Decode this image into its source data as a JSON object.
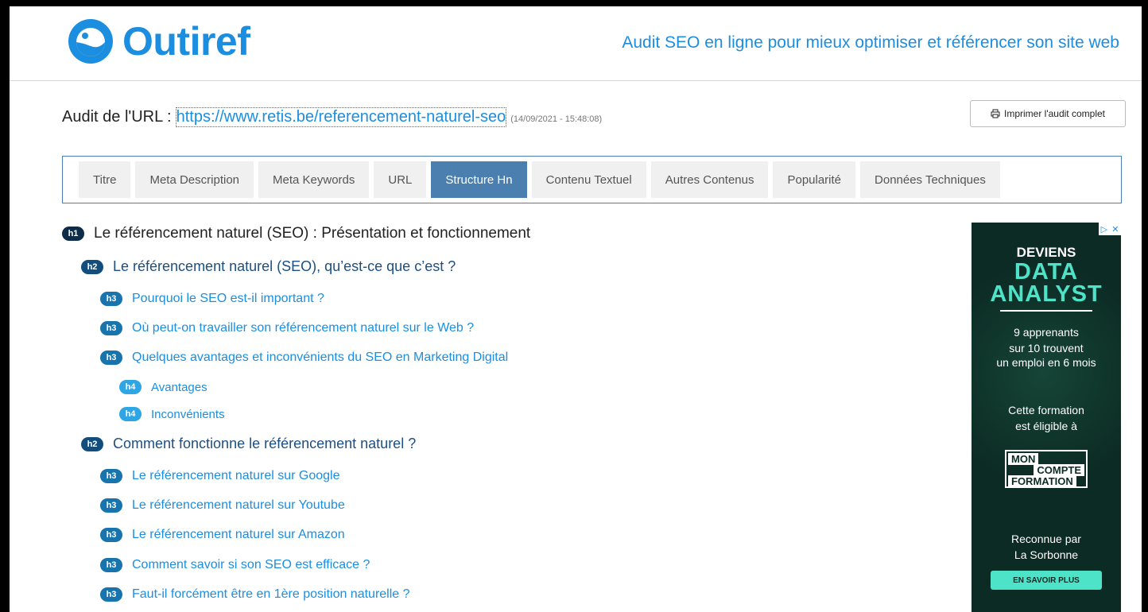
{
  "header": {
    "brand": "Outiref",
    "tagline": "Audit SEO en ligne pour mieux optimiser et référencer son site web"
  },
  "audit": {
    "label": "Audit de l'URL :",
    "url": "https://www.retis.be/referencement-naturel-seo",
    "date": "(14/09/2021 - 15:48:08)",
    "print_label": "Imprimer l'audit complet"
  },
  "tabs": [
    {
      "label": "Titre"
    },
    {
      "label": "Meta Description"
    },
    {
      "label": "Meta Keywords"
    },
    {
      "label": "URL"
    },
    {
      "label": "Structure Hn",
      "active": true
    },
    {
      "label": "Contenu Textuel"
    },
    {
      "label": "Autres Contenus"
    },
    {
      "label": "Popularité"
    },
    {
      "label": "Données Techniques"
    }
  ],
  "headings": [
    {
      "level": "h1",
      "text": "Le référencement naturel (SEO) : Présentation et fonctionnement"
    },
    {
      "level": "h2",
      "text": "Le référencement naturel (SEO), qu’est-ce que c’est ?"
    },
    {
      "level": "h3",
      "text": "Pourquoi le SEO est-il important ?"
    },
    {
      "level": "h3",
      "text": "Où peut-on travailler son référencement naturel sur le Web ?"
    },
    {
      "level": "h3",
      "text": "Quelques avantages et inconvénients du SEO en Marketing Digital"
    },
    {
      "level": "h4",
      "text": "Avantages"
    },
    {
      "level": "h4",
      "text": "Inconvénients"
    },
    {
      "level": "h2",
      "text": "Comment fonctionne le référencement naturel ?"
    },
    {
      "level": "h3",
      "text": "Le référencement naturel sur Google"
    },
    {
      "level": "h3",
      "text": "Le référencement naturel sur Youtube"
    },
    {
      "level": "h3",
      "text": "Le référencement naturel sur Amazon"
    },
    {
      "level": "h3",
      "text": "Comment savoir si son SEO est efficace ?"
    },
    {
      "level": "h3",
      "text": "Faut-il forcément être en 1ère position naturelle ?"
    }
  ],
  "ad": {
    "line1": "DEVIENS",
    "line2": "DATA",
    "line3": "ANALYST",
    "stat1": "9 apprenants",
    "stat2": "sur 10 trouvent",
    "stat3": "un emploi en 6 mois",
    "elig1": "Cette formation",
    "elig2": "est éligible à",
    "mcf1": "MON",
    "mcf2": "COMPTE",
    "mcf3": "FORMATION",
    "rec1": "Reconnue par",
    "rec2": "La Sorbonne",
    "cta": "EN SAVOIR PLUS"
  },
  "colors": {
    "brand": "#1b8ee0",
    "tab_active": "#4a7fb0",
    "ad_bg": "#0c2b24",
    "ad_accent": "#4de3c8"
  }
}
